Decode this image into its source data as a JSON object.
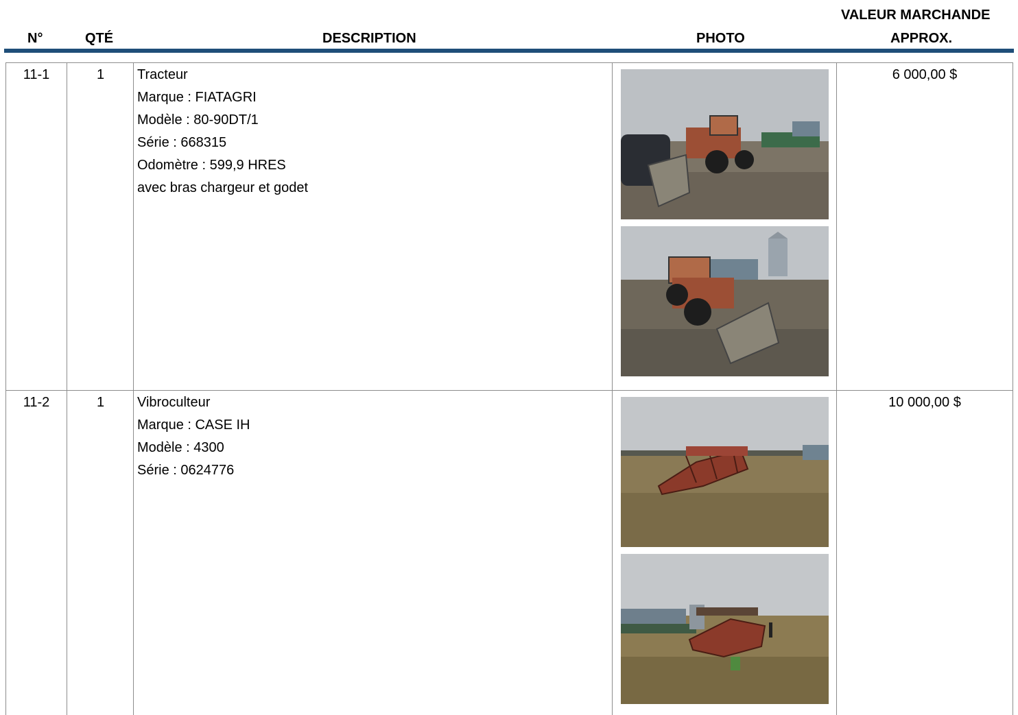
{
  "header": {
    "col_no": "N°",
    "col_qty": "QTÉ",
    "col_desc": "DESCRIPTION",
    "col_photo": "PHOTO",
    "col_value_line1": "VALEUR MARCHANDE",
    "col_value_line2": "APPROX."
  },
  "items": [
    {
      "no": "11-1",
      "qty": "1",
      "lines": [
        "Tracteur",
        "Marque : FIATAGRI",
        "Modèle : 80-90DT/1",
        "Série : 668315",
        "Odomètre : 599,9 HRES",
        "avec bras chargeur et godet"
      ],
      "value": "6 000,00 $"
    },
    {
      "no": "11-2",
      "qty": "1",
      "lines": [
        "Vibroculteur",
        "Marque : CASE IH",
        "Modèle : 4300",
        "Série : 0624776"
      ],
      "value": "10 000,00 $"
    }
  ],
  "colors": {
    "header_rule": "#1f4e79",
    "grid": "#8c8c8c"
  }
}
